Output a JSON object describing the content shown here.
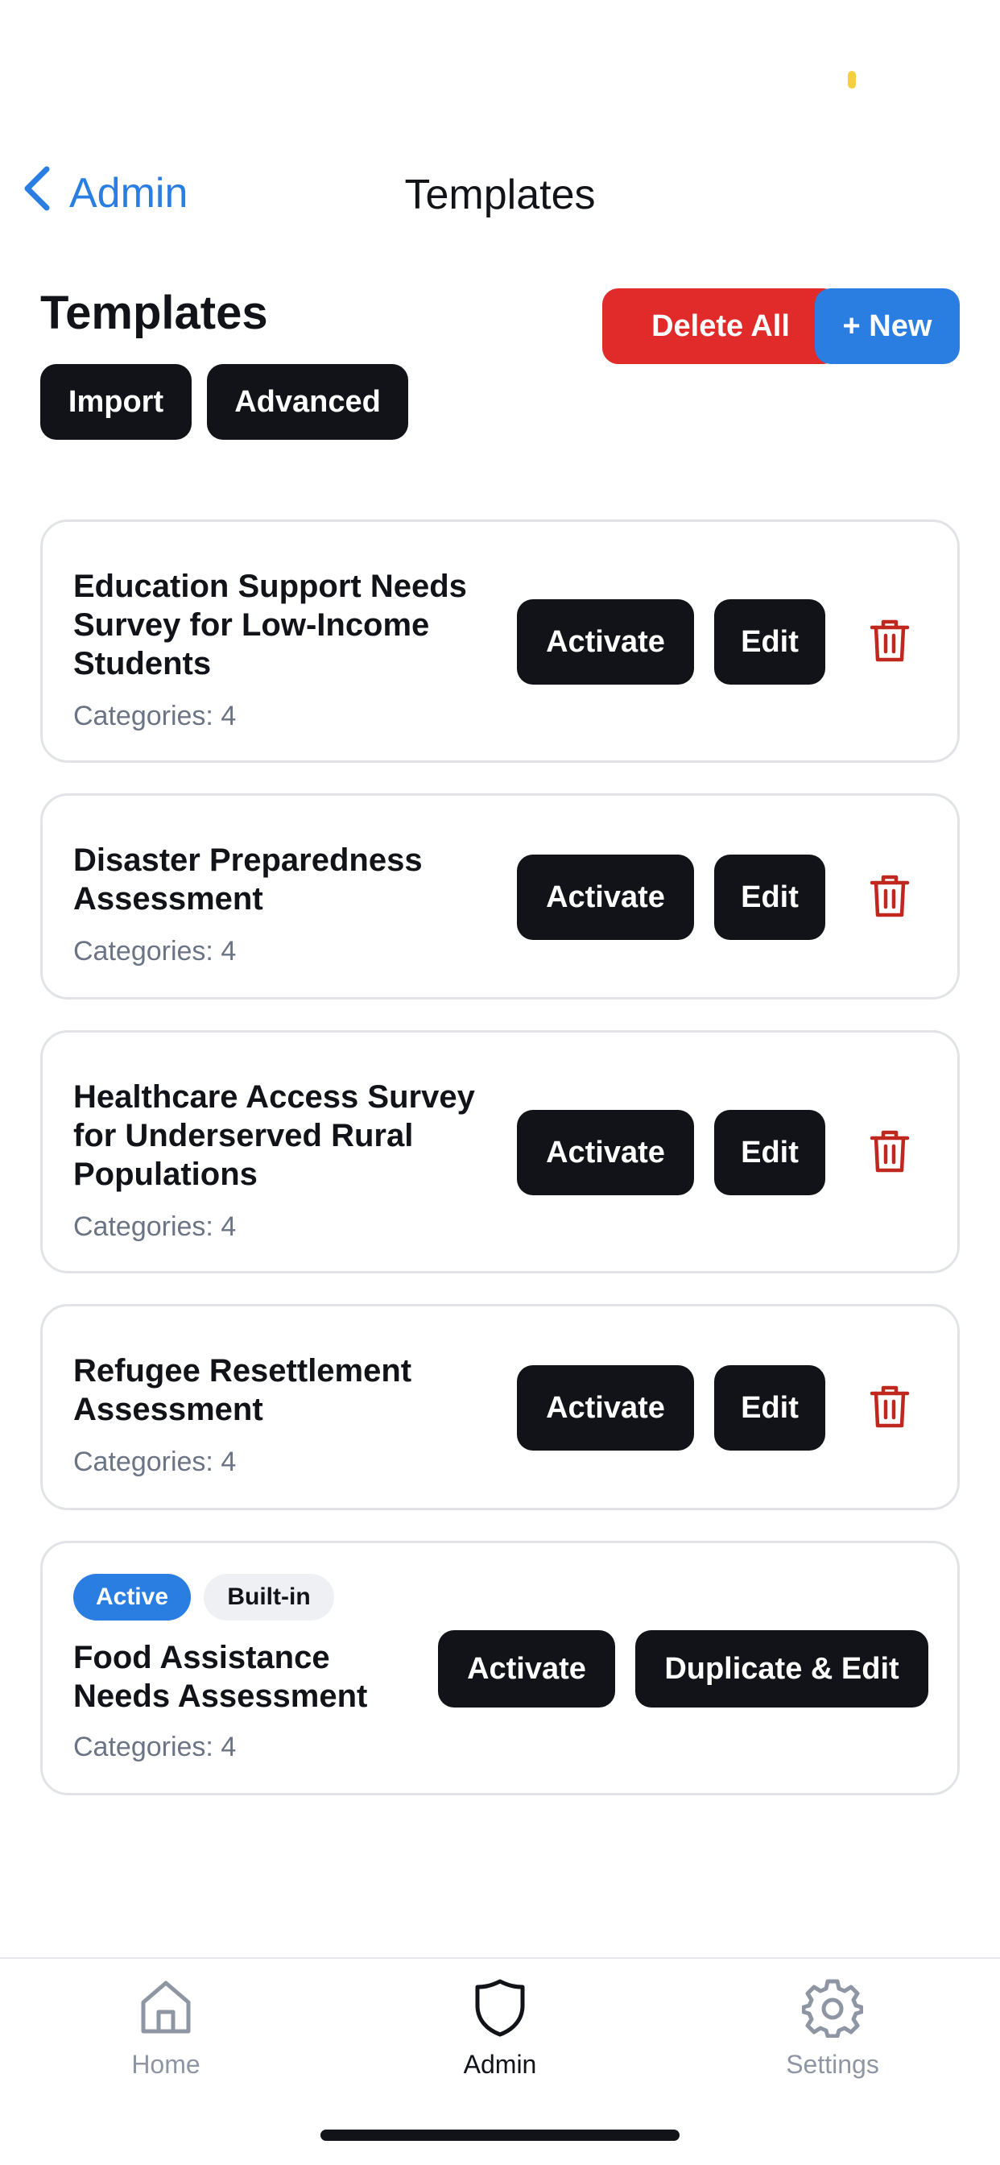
{
  "nav": {
    "back_label": "Admin",
    "title": "Templates"
  },
  "header": {
    "title": "Templates",
    "delete_all_label": "Delete All",
    "new_label": "+ New",
    "import_label": "Import",
    "advanced_label": "Advanced"
  },
  "templates": [
    {
      "title": "Education Support Needs Survey for Low-Income Students",
      "categories": "Categories: 4",
      "activate_label": "Activate",
      "edit_label": "Edit"
    },
    {
      "title": "Disaster Preparedness Assessment",
      "categories": "Categories: 4",
      "activate_label": "Activate",
      "edit_label": "Edit"
    },
    {
      "title": "Healthcare Access Survey for Underserved Rural Populations",
      "categories": "Categories: 4",
      "activate_label": "Activate",
      "edit_label": "Edit"
    },
    {
      "title": "Refugee Resettlement Assessment",
      "categories": "Categories: 4",
      "activate_label": "Activate",
      "edit_label": "Edit"
    },
    {
      "title": "Food Assistance Needs Assessment",
      "categories": "Categories: 4",
      "active_badge": "Active",
      "builtin_badge": "Built-in",
      "activate_label": "Activate",
      "duplicate_label": "Duplicate & Edit"
    }
  ],
  "tabbar": {
    "home_label": "Home",
    "admin_label": "Admin",
    "settings_label": "Settings",
    "active_tab": "Admin"
  },
  "colors": {
    "accent_blue": "#2a7de1",
    "danger_red": "#e12a2a",
    "trash_red": "#c0281f",
    "dark": "#111318"
  }
}
